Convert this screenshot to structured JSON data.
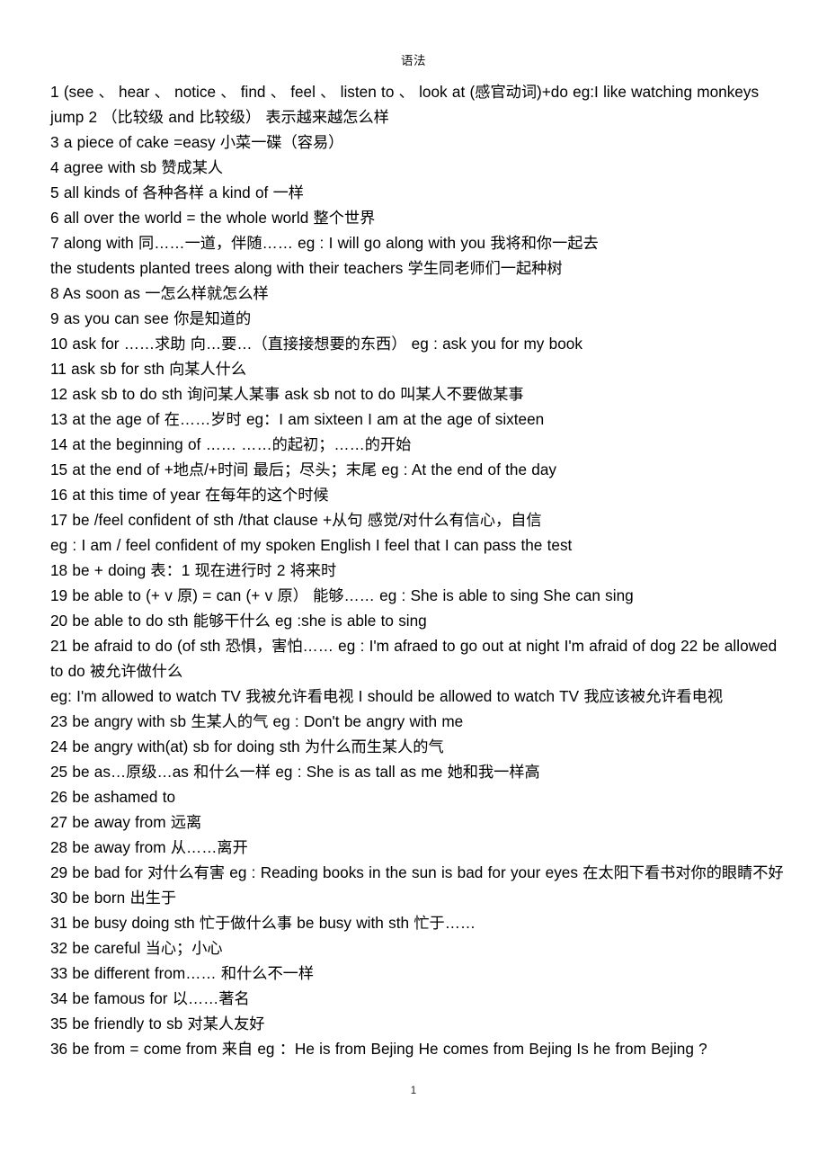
{
  "document": {
    "header": "语法",
    "page_number": "1",
    "entries": [
      "1 (see 、 hear 、 notice 、 find 、 feel 、 listen to 、  look at (感官动词)+do eg:I like watching monkeys jump 2 （比较级 and 比较级） 表示越来越怎么样",
      "3 a piece of cake =easy 小菜一碟（容易）",
      "4 agree with sb 赞成某人",
      "5 all kinds of 各种各样 a kind of 一样",
      "6 all over the world = the whole world 整个世界",
      "7 along with 同……一道，伴随…… eg : I will go along with you 我将和你一起去",
      "the students planted trees along with their teachers 学生同老师们一起种树",
      "8 As soon as 一怎么样就怎么样",
      "9 as you can see 你是知道的",
      "10 ask for ……求助 向…要…（直接接想要的东西） eg : ask you for my book",
      "11 ask sb for sth 向某人什么",
      "12 ask sb to do sth 询问某人某事 ask sb not to do 叫某人不要做某事",
      "13 at the age of 在……岁时 eg：I am sixteen I am at the age of sixteen",
      "14 at the beginning of …… ……的起初；……的开始",
      "15 at the end of +地点/+时间 最后；尽头；末尾 eg : At the end of the day",
      "16 at this time of year 在每年的这个时候",
      "17 be /feel confident of sth /that clause +从句 感觉/对什么有信心，自信",
      "eg : I am / feel confident of my spoken English I feel that I can pass the test",
      "18 be + doing 表：1 现在进行时 2 将来时",
      "19 be able to (+ v 原) = can (+ v 原） 能够…… eg : She is able to sing She can sing",
      "20 be able to do sth 能够干什么 eg :she is able to sing",
      "21 be afraid to do (of sth 恐惧，害怕…… eg : I'm afraed to go out at night I'm afraid of dog 22 be allowed to do 被允许做什么",
      "eg: I'm allowed to watch TV 我被允许看电视 I should be allowed to watch TV 我应该被允许看电视",
      "23 be angry with sb 生某人的气 eg : Don't be angry with me",
      "24 be angry with(at) sb for doing sth 为什么而生某人的气",
      "25 be as…原级…as 和什么一样 eg : She is as tall as me 她和我一样高",
      "26 be ashamed to",
      "27 be away from 远离",
      "28 be away from 从……离开",
      "29 be bad for 对什么有害 eg : Reading books in the sun is bad for your eyes 在太阳下看书对你的眼睛不好",
      "30 be born 出生于",
      "31 be busy doing sth 忙于做什么事 be busy with sth 忙于……",
      "32 be careful 当心；小心",
      "33 be different from…… 和什么不一样",
      "34 be famous for 以……著名",
      "35 be friendly to sb 对某人友好",
      "36 be from = come from 来自 eg ：He is from Bejing He comes from Bejing Is he from Bejing ?"
    ]
  }
}
